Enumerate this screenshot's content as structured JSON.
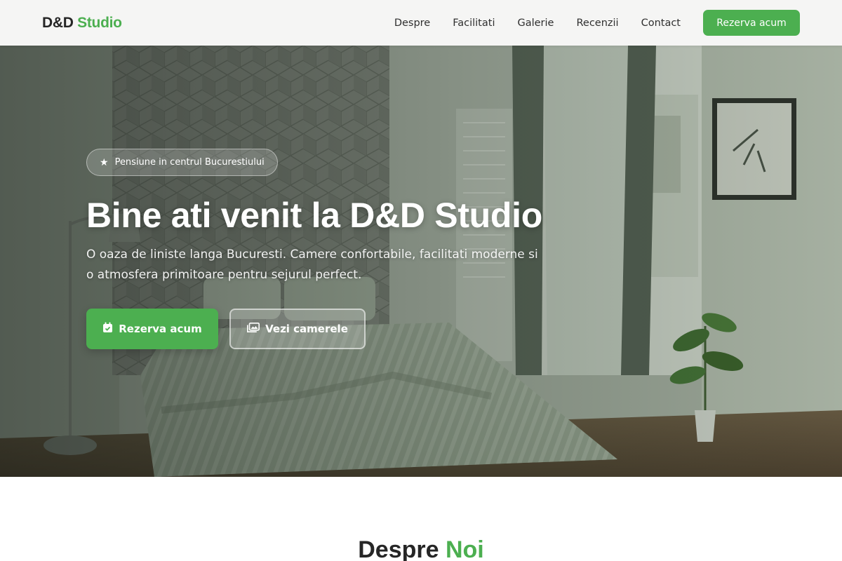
{
  "brand": {
    "name_part1": "D&D",
    "name_part2": "Studio",
    "accent_color": "#4caf50"
  },
  "nav": {
    "links": [
      "Despre",
      "Facilitati",
      "Galerie",
      "Recenzii",
      "Contact"
    ],
    "cta_label": "Rezerva acum"
  },
  "hero": {
    "badge_icon": "star-icon",
    "badge_text": "Pensiune in centrul Bucurestiului",
    "title": "Bine ati venit la D&D Studio",
    "subtitle": "O oaza de liniste langa Bucuresti. Camere confortabile, facilitati moderne si o atmosfera primitoare pentru sejurul perfect.",
    "primary_button": {
      "label": "Rezerva acum",
      "icon": "calendar-check-icon"
    },
    "secondary_button": {
      "label": "Vezi camerele",
      "icon": "photos-icon"
    }
  },
  "about": {
    "title_part1": "Despre",
    "title_part2": "Noi"
  }
}
